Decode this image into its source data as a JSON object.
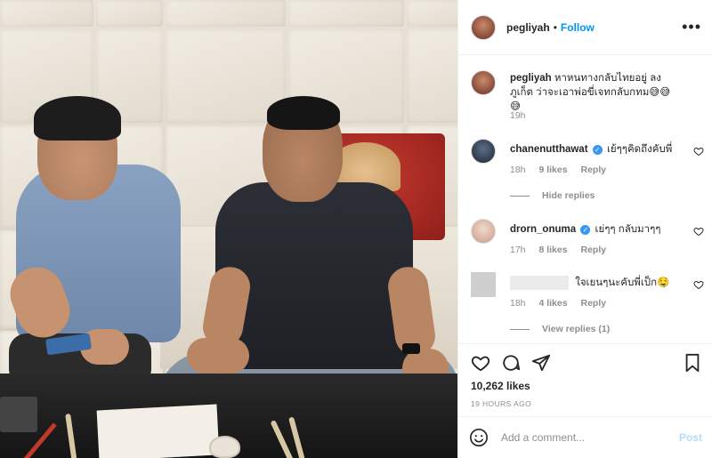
{
  "post": {
    "username": "pegliyah",
    "follow_label": "Follow",
    "separator": "•",
    "more_label": "•••"
  },
  "caption": {
    "username": "pegliyah",
    "text": "หาหนทางกลับไทยอยู่ ลงภูเก็ต ว่าจะเอาพ่อขี่เจทกลับกทม😅😅😅",
    "time": "19h"
  },
  "comments": [
    {
      "username": "chanenutthawat",
      "verified": true,
      "text": "เย้ๆๆคิดถึงคับพี่",
      "time": "18h",
      "likes": "9 likes",
      "reply": "Reply",
      "replies_toggle": "Hide replies"
    },
    {
      "username": "drorn_onuma",
      "verified": true,
      "text": "เย่ๆๆ กลับมาๆๆ",
      "time": "17h",
      "likes": "8 likes",
      "reply": "Reply"
    },
    {
      "username": "",
      "verified": false,
      "text": "ใจเยนๆนะคับพี่เป็ก🤤",
      "time": "18h",
      "likes": "4 likes",
      "reply": "Reply",
      "replies_toggle": "View replies (1)"
    }
  ],
  "stats": {
    "likes": "10,262 likes",
    "posted_ago": "19 HOURS AGO"
  },
  "composer": {
    "placeholder": "Add a comment...",
    "post_label": "Post"
  },
  "colors": {
    "link_blue": "#0095f6",
    "post_disabled": "#b3dbff",
    "verified": "#3897f0",
    "muted": "#8e8e8e"
  },
  "icons": [
    "heart-icon",
    "comment-icon",
    "share-icon",
    "bookmark-icon",
    "emoji-icon",
    "more-icon",
    "verified-icon"
  ]
}
